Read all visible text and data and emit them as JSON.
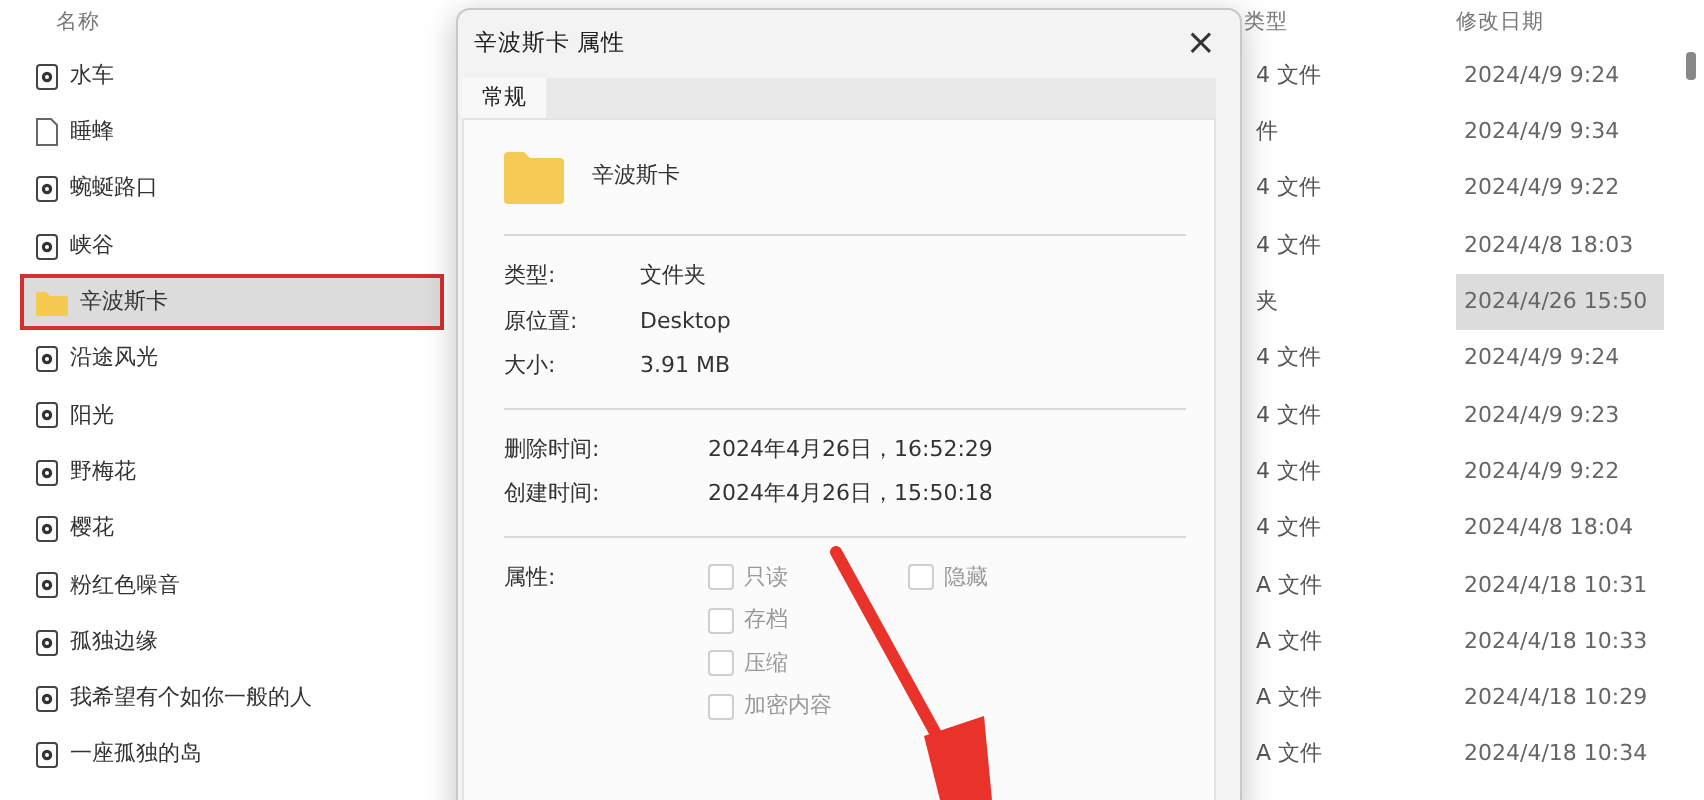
{
  "explorer": {
    "columns": [
      "名称",
      "类型",
      "修改日期"
    ],
    "rows": [
      {
        "name": "水车",
        "kind": "media",
        "type": "4 文件",
        "modified": "2024/4/9 9:24",
        "selected": false,
        "highlighted": false
      },
      {
        "name": "睡蜂",
        "kind": "document",
        "type": "件",
        "modified": "2024/4/9 9:34",
        "selected": false,
        "highlighted": false
      },
      {
        "name": "蜿蜒路口",
        "kind": "media",
        "type": "4 文件",
        "modified": "2024/4/9 9:22",
        "selected": false,
        "highlighted": false
      },
      {
        "name": "峡谷",
        "kind": "media",
        "type": "4 文件",
        "modified": "2024/4/8 18:03",
        "selected": false,
        "highlighted": false
      },
      {
        "name": "辛波斯卡",
        "kind": "folder",
        "type": "夹",
        "modified": "2024/4/26 15:50",
        "selected": true,
        "highlighted": true
      },
      {
        "name": "沿途风光",
        "kind": "media",
        "type": "4 文件",
        "modified": "2024/4/9 9:24",
        "selected": false,
        "highlighted": false
      },
      {
        "name": "阳光",
        "kind": "media",
        "type": "4 文件",
        "modified": "2024/4/9 9:23",
        "selected": false,
        "highlighted": false
      },
      {
        "name": "野梅花",
        "kind": "media",
        "type": "4 文件",
        "modified": "2024/4/9 9:22",
        "selected": false,
        "highlighted": false
      },
      {
        "name": "樱花",
        "kind": "media",
        "type": "4 文件",
        "modified": "2024/4/8 18:04",
        "selected": false,
        "highlighted": false
      },
      {
        "name": "粉红色噪音",
        "kind": "media",
        "type": "A 文件",
        "modified": "2024/4/18 10:31",
        "selected": false,
        "highlighted": false
      },
      {
        "name": "孤独边缘",
        "kind": "media",
        "type": "A 文件",
        "modified": "2024/4/18 10:33",
        "selected": false,
        "highlighted": false
      },
      {
        "name": "我希望有个如你一般的人",
        "kind": "media",
        "type": "A 文件",
        "modified": "2024/4/18 10:29",
        "selected": false,
        "highlighted": false
      },
      {
        "name": "一座孤独的岛",
        "kind": "media",
        "type": "A 文件",
        "modified": "2024/4/18 10:34",
        "selected": false,
        "highlighted": false
      }
    ]
  },
  "dialog": {
    "title": "辛波斯卡 属性",
    "close": "×",
    "tabs": [
      {
        "label": "常规",
        "selected": true
      }
    ],
    "name": "辛波斯卡",
    "properties": [
      {
        "label": "类型:",
        "value": "文件夹"
      },
      {
        "label": "原位置:",
        "value": "Desktop"
      },
      {
        "label": "大小:",
        "value": "3.91 MB"
      }
    ],
    "times": [
      {
        "label": "删除时间:",
        "value": "2024年4月26日，16:52:29"
      },
      {
        "label": "创建时间:",
        "value": "2024年4月26日，15:50:18"
      }
    ],
    "attributes_label": "属性:",
    "attributes": [
      [
        {
          "label": "只读",
          "checked": false
        },
        {
          "label": "存档",
          "checked": false
        },
        {
          "label": "压缩",
          "checked": false
        },
        {
          "label": "加密内容",
          "checked": false
        }
      ],
      [
        {
          "label": "隐藏",
          "checked": false
        }
      ]
    ]
  }
}
